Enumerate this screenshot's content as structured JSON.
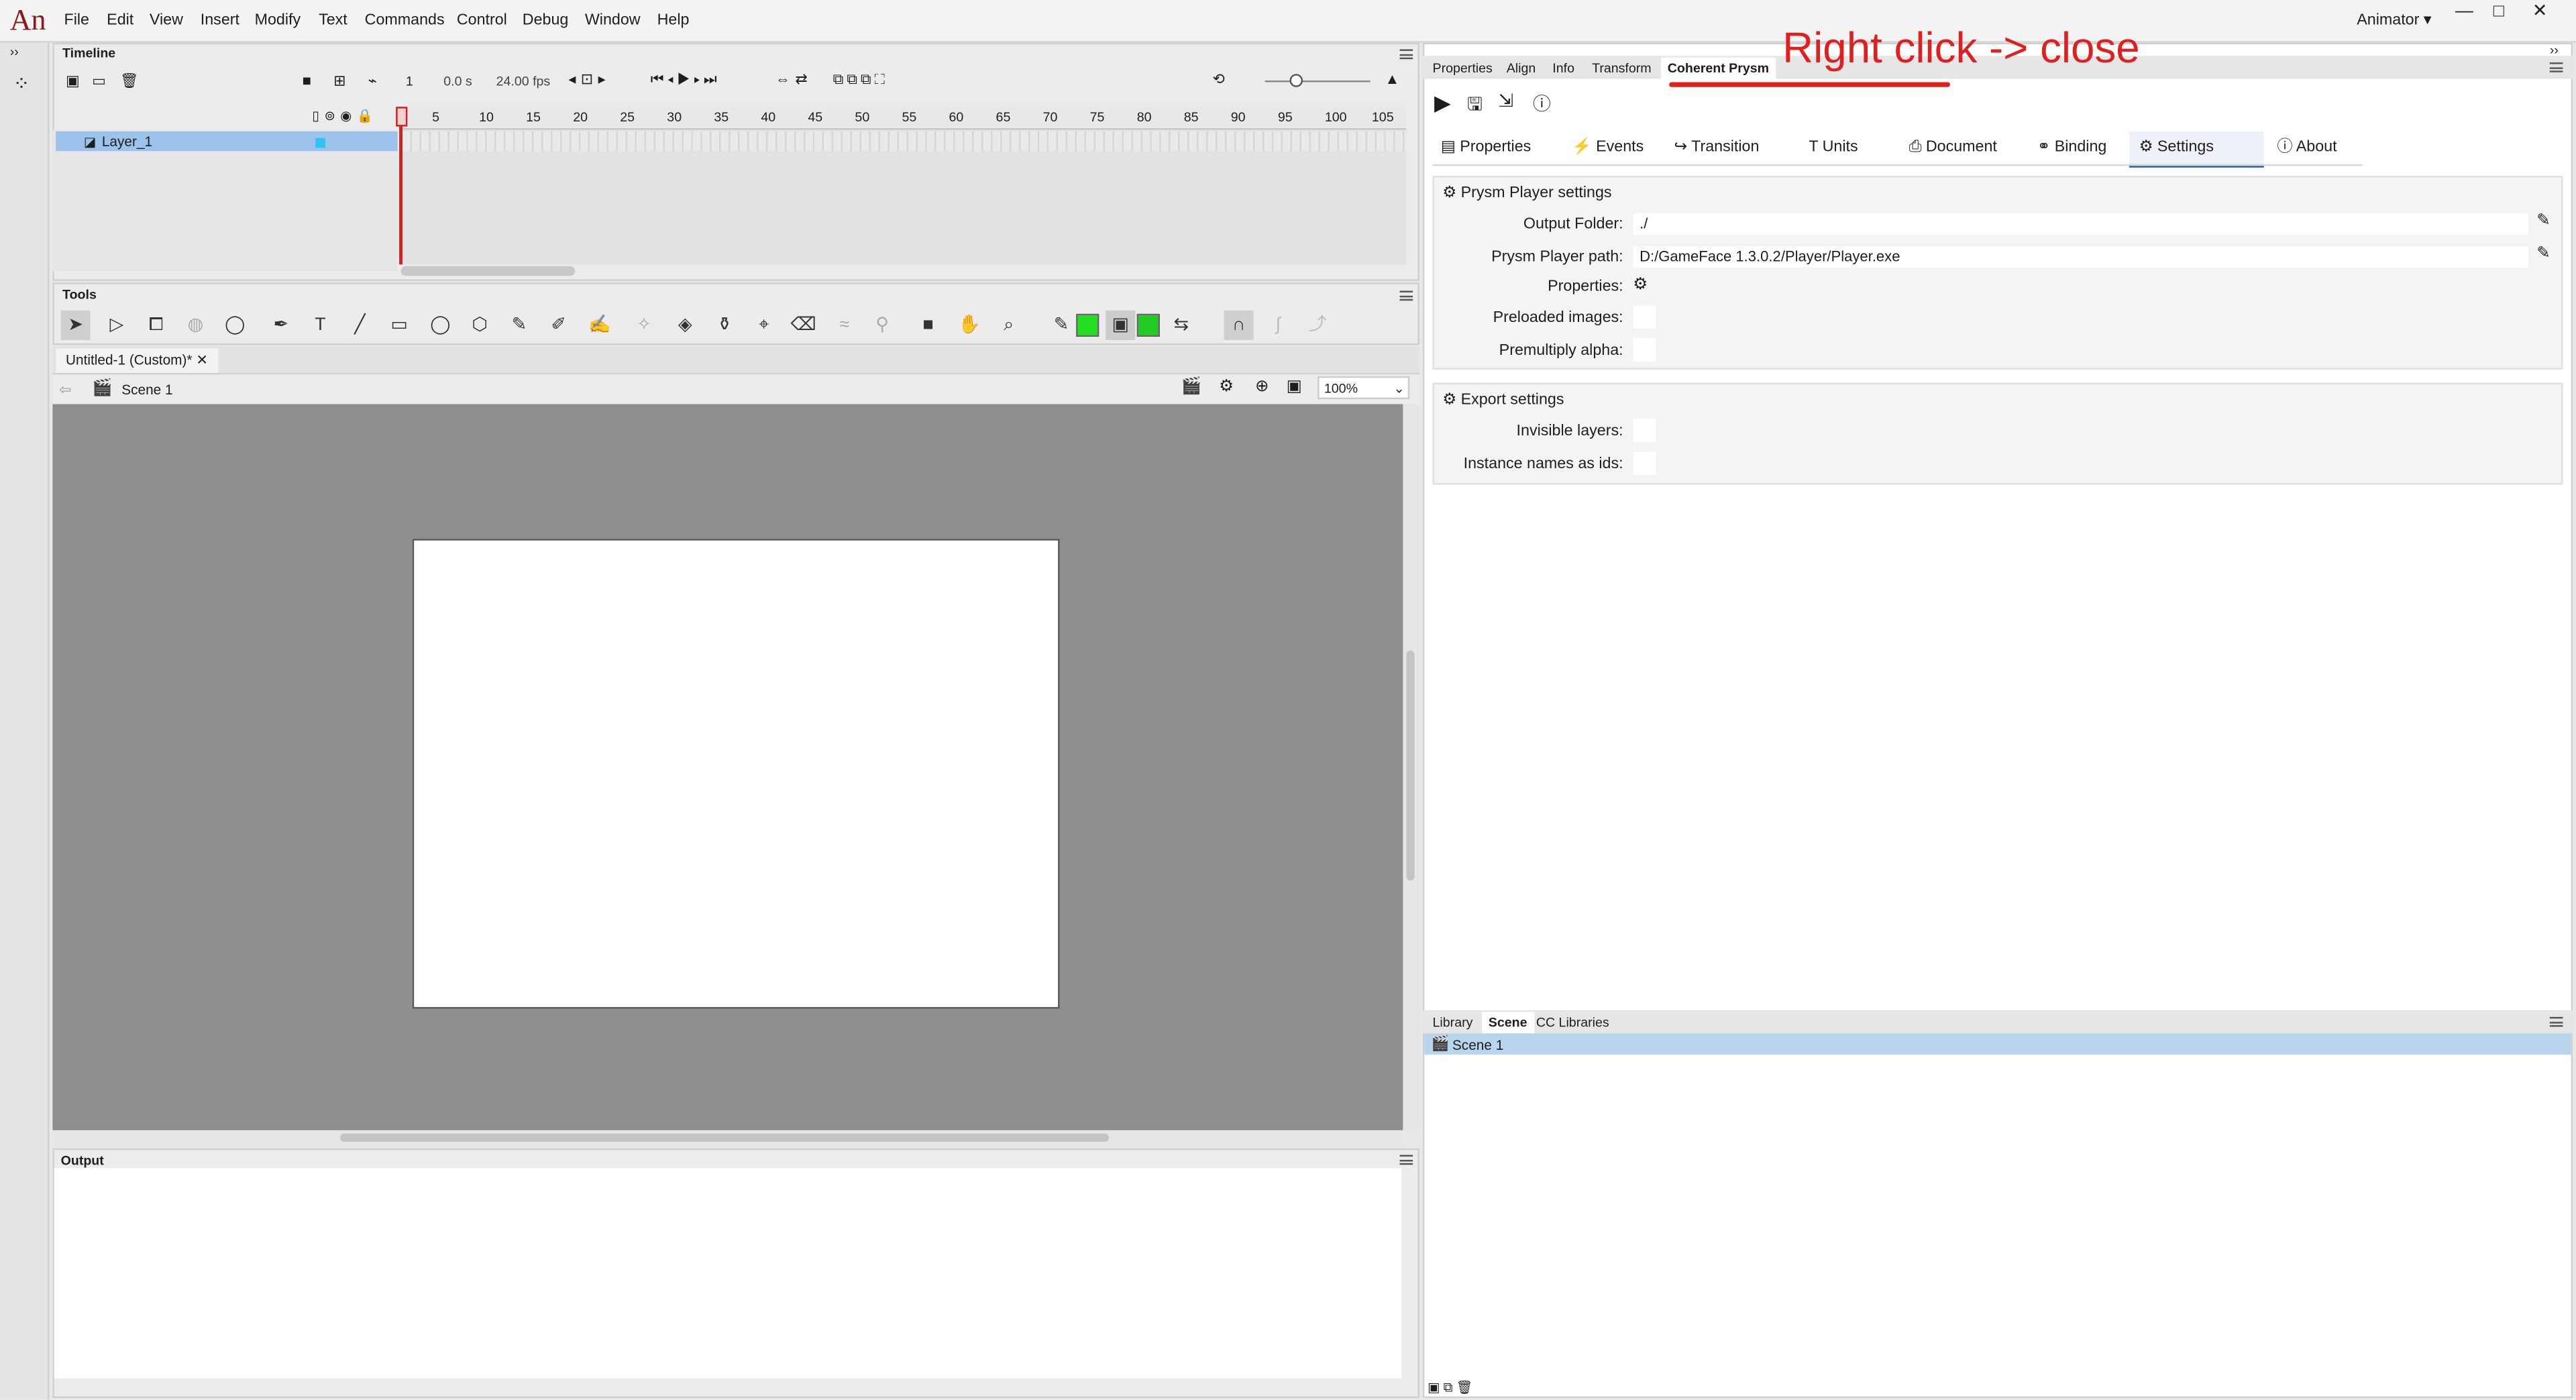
{
  "app": {
    "logo": "An",
    "workspace": "Animator",
    "window_buttons": {
      "minimize": "—",
      "maximize": "□",
      "close": "✕"
    }
  },
  "menu": [
    "File",
    "Edit",
    "View",
    "Insert",
    "Modify",
    "Text",
    "Commands",
    "Control",
    "Debug",
    "Window",
    "Help"
  ],
  "timeline": {
    "title": "Timeline",
    "time": "0.0 s",
    "fps": "24.00 fps",
    "frame": "1",
    "layer": "Layer_1",
    "ruler": [
      "5",
      "10",
      "15",
      "20",
      "25",
      "30",
      "35",
      "40",
      "45",
      "50",
      "55",
      "60",
      "65",
      "70",
      "75",
      "80",
      "85",
      "90",
      "95",
      "100",
      "105"
    ]
  },
  "tools": {
    "title": "Tools",
    "fill_color": "#22cc22",
    "stroke_color": "#22dd22"
  },
  "document": {
    "tab": "Untitled-1 (Custom)*",
    "scene": "Scene 1",
    "zoom": "100%"
  },
  "output": {
    "title": "Output"
  },
  "right": {
    "tabs": [
      "Properties",
      "Align",
      "Info",
      "Transform",
      "Coherent Prysm"
    ],
    "annotation": "Right click -> close",
    "subtabs": [
      "Properties",
      "Events",
      "Transition",
      "Units",
      "Document",
      "Binding",
      "Settings",
      "About"
    ],
    "prysm_section": "Prysm Player settings",
    "output_folder_label": "Output Folder:",
    "output_folder": "./",
    "player_path_label": "Prysm Player path:",
    "player_path": "D:/GameFace 1.3.0.2/Player/Player.exe",
    "properties_label": "Properties:",
    "preloaded_label": "Preloaded images:",
    "premultiply_label": "Premultiply alpha:",
    "export_section": "Export settings",
    "invisible_label": "Invisible layers:",
    "instance_label": "Instance names as ids:"
  },
  "library": {
    "tabs": [
      "Library",
      "Scene",
      "CC Libraries"
    ],
    "item": "Scene 1"
  }
}
